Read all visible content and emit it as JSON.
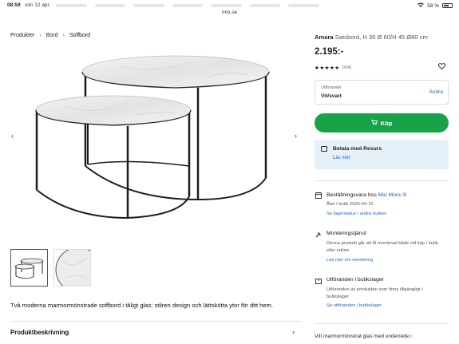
{
  "status": {
    "time": "08:59",
    "date": "sön 12 apr.",
    "battery": "58 %"
  },
  "browser": {
    "url": "mio.se"
  },
  "breadcrumb": [
    "Produkter",
    "Bord",
    "Soffbord"
  ],
  "product": {
    "name": "Amara",
    "subtitle": "Satsbord, H 35 Ø 60/H 45 Ø80 cm",
    "price": "2.195:-",
    "stars": "★★★★★",
    "rating_count": "(264)",
    "rating_value": 4.5,
    "description": "Två moderna marmormönstrade soffbord i tåligt glas; stilren design och lättskötta ytor för ditt hem.",
    "description_header": "Produktbeskrivning",
    "more_text": "Vitt marmormönstrat glas med underrede i"
  },
  "variant": {
    "label": "Utförande",
    "value": "Vit/svart",
    "change": "Ändra"
  },
  "buy_button": {
    "label": "Köp"
  },
  "resurs": {
    "title": "Betala med Resurs",
    "link": "Läs mer"
  },
  "delivery": {
    "title_prefix": "Beställningsvara hos",
    "store": "Mio Mora",
    "line": "Åter i butik 2026-04-15",
    "link": "Se lagerstatus i andra butiker"
  },
  "assembly": {
    "title": "Monteringstjänst",
    "text": "Denna produkt går att få monterad både vid köp i butik eller online.",
    "link": "Läs mer om montering"
  },
  "instore": {
    "title": "Utföranden i butikslager",
    "text": "Utföranden av produkten som finns tillgängligt i butikslager",
    "link": "Se utföranden i butikslager"
  },
  "icons": {
    "arrow_left": "chevron-left-icon",
    "arrow_right": "chevron-right-icon",
    "heart": "heart-icon",
    "cart": "cart-icon",
    "card": "card-icon",
    "store": "store-icon",
    "hammer": "hammer-icon",
    "box": "box-icon"
  },
  "colors": {
    "accent_green": "#18a34a",
    "link_blue": "#1e66c9",
    "resurs_bg": "#e6f0f8"
  }
}
